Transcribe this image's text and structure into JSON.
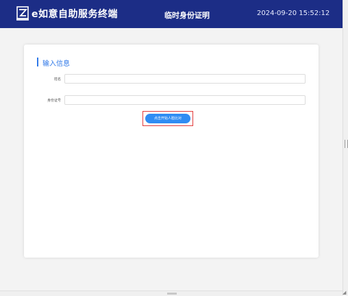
{
  "header": {
    "app_title": "e如意自助服务终端",
    "page_title": "临时身份证明",
    "datetime": "2024-09-20 15:52:12",
    "logo_icon": "app-logo-icon",
    "background": "#1c2d86"
  },
  "form": {
    "section_title": "输入信息",
    "name_label": "姓名",
    "name_value": "",
    "id_label": "身份证号",
    "id_value": "",
    "start_button_label": "点击开始人脸比对",
    "accent": "#2f78e8",
    "button_color": "#2f8cf3",
    "highlight_color": "#e23a3a"
  }
}
